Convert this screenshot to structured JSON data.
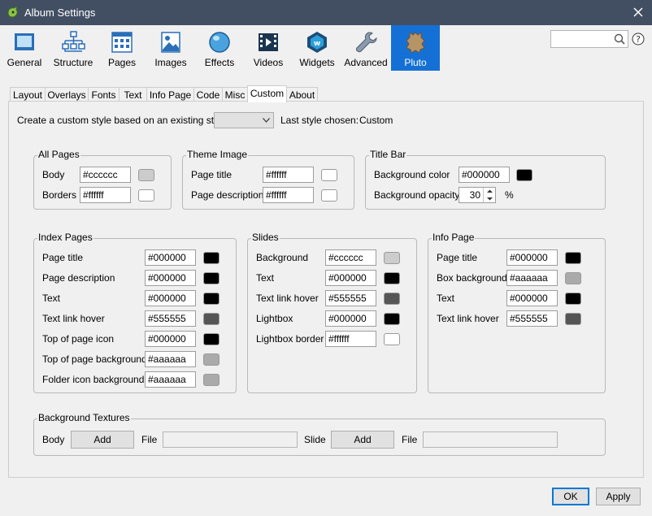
{
  "window": {
    "title": "Album Settings"
  },
  "toolbar": {
    "items": [
      {
        "label": "General",
        "icon": "window-icon"
      },
      {
        "label": "Structure",
        "icon": "tree-icon"
      },
      {
        "label": "Pages",
        "icon": "pages-grid-icon"
      },
      {
        "label": "Images",
        "icon": "image-icon"
      },
      {
        "label": "Effects",
        "icon": "circle-icon"
      },
      {
        "label": "Videos",
        "icon": "film-icon"
      },
      {
        "label": "Widgets",
        "icon": "widget-hexagon-icon"
      },
      {
        "label": "Advanced",
        "icon": "wrench-icon"
      },
      {
        "label": "Pluto",
        "icon": "pluto-leather-icon",
        "active": true
      }
    ],
    "accent": "#1570d6"
  },
  "search": {
    "placeholder": ""
  },
  "tabs": [
    "Layout",
    "Overlays",
    "Fonts",
    "Text",
    "Info Page",
    "Code",
    "Misc",
    "Custom",
    "About"
  ],
  "active_tab": "Custom",
  "custom": {
    "create_label": "Create a custom style based on an existing style",
    "dropdown_value": "",
    "last_style_label": "Last style chosen:",
    "last_style_value": "Custom"
  },
  "all_pages": {
    "title": "All Pages",
    "rows": [
      {
        "label": "Body",
        "value": "#cccccc",
        "swatch": "#cccccc"
      },
      {
        "label": "Borders",
        "value": "#ffffff",
        "swatch": "#ffffff"
      }
    ]
  },
  "theme_image": {
    "title": "Theme Image",
    "rows": [
      {
        "label": "Page title",
        "value": "#ffffff",
        "swatch": "#ffffff"
      },
      {
        "label": "Page description",
        "value": "#ffffff",
        "swatch": "#ffffff"
      }
    ]
  },
  "title_bar": {
    "title": "Title Bar",
    "bg_color_label": "Background color",
    "bg_color_value": "#000000",
    "bg_color_swatch": "#000000",
    "bg_opacity_label": "Background opacity",
    "bg_opacity_value": "30",
    "bg_opacity_unit": "%"
  },
  "index_pages": {
    "title": "Index Pages",
    "rows": [
      {
        "label": "Page title",
        "value": "#000000",
        "swatch": "#000000"
      },
      {
        "label": "Page description",
        "value": "#000000",
        "swatch": "#000000"
      },
      {
        "label": "Text",
        "value": "#000000",
        "swatch": "#000000"
      },
      {
        "label": "Text link hover",
        "value": "#555555",
        "swatch": "#555555"
      },
      {
        "label": "Top of page icon",
        "value": "#000000",
        "swatch": "#000000"
      },
      {
        "label": "Top of page background",
        "value": "#aaaaaa",
        "swatch": "#aaaaaa"
      },
      {
        "label": "Folder icon background",
        "value": "#aaaaaa",
        "swatch": "#aaaaaa"
      }
    ]
  },
  "slides": {
    "title": "Slides",
    "rows": [
      {
        "label": "Background",
        "value": "#cccccc",
        "swatch": "#cccccc"
      },
      {
        "label": "Text",
        "value": "#000000",
        "swatch": "#000000"
      },
      {
        "label": "Text link hover",
        "value": "#555555",
        "swatch": "#555555"
      },
      {
        "label": "Lightbox",
        "value": "#000000",
        "swatch": "#000000"
      },
      {
        "label": "Lightbox border",
        "value": "#ffffff",
        "swatch": "#ffffff"
      }
    ]
  },
  "info_page": {
    "title": "Info Page",
    "rows": [
      {
        "label": "Page title",
        "value": "#000000",
        "swatch": "#000000"
      },
      {
        "label": "Box background",
        "value": "#aaaaaa",
        "swatch": "#aaaaaa"
      },
      {
        "label": "Text",
        "value": "#000000",
        "swatch": "#000000"
      },
      {
        "label": "Text link hover",
        "value": "#555555",
        "swatch": "#555555"
      }
    ]
  },
  "textures": {
    "title": "Background Textures",
    "body_label": "Body",
    "add_label": "Add",
    "file_label": "File",
    "body_file": "",
    "slide_label": "Slide",
    "slide_file": ""
  },
  "footer": {
    "ok_label": "OK",
    "apply_label": "Apply"
  }
}
